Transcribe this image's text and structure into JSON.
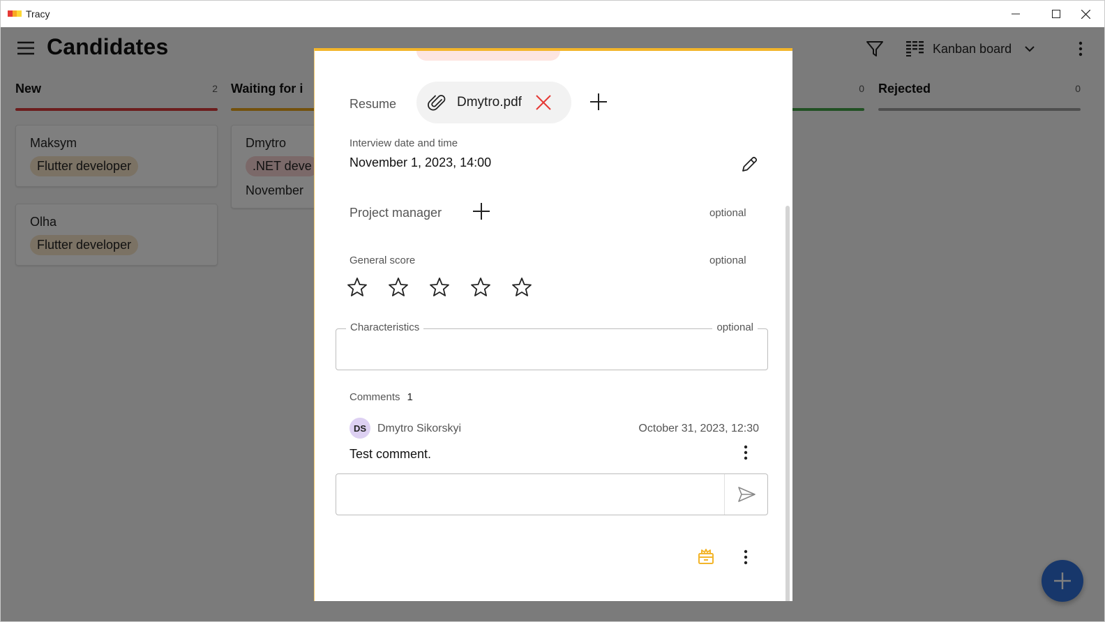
{
  "window": {
    "title": "Tracy",
    "logo_colors": [
      "#e53935",
      "#f9a825",
      "#fdd835"
    ]
  },
  "toolbar": {
    "title": "Candidates",
    "view_label": "Kanban board"
  },
  "columns": [
    {
      "name": "New",
      "count": "2",
      "color": "#d93a3a",
      "cards": [
        {
          "name": "Maksym",
          "position": "Flutter developer",
          "chip_color": "#f6e5c8"
        },
        {
          "name": "Olha",
          "position": "Flutter developer",
          "chip_color": "#f6e5c8"
        }
      ]
    },
    {
      "name": "Waiting for i",
      "count": "",
      "color": "#e6a21a",
      "cards": [
        {
          "name": "Dmytro",
          "position": ".NET deve",
          "chip_color": "#f6d2d2",
          "date": "November"
        }
      ]
    },
    {
      "name": "",
      "count": "0",
      "color": "#43a047",
      "cards": []
    },
    {
      "name": "Rejected",
      "count": "0",
      "color": "#9e9e9e",
      "cards": []
    }
  ],
  "dialog": {
    "resume": {
      "label": "Resume",
      "file_name": "Dmytro.pdf"
    },
    "interview": {
      "label": "Interview date and time",
      "value": "November 1, 2023, 14:00"
    },
    "project_manager": {
      "label": "Project manager",
      "optional": "optional"
    },
    "general_score": {
      "label": "General score",
      "optional": "optional",
      "rating": 0,
      "max": 5
    },
    "characteristics": {
      "label": "Characteristics",
      "optional": "optional",
      "value": ""
    },
    "comments": {
      "label": "Comments",
      "count": "1",
      "items": [
        {
          "initials": "DS",
          "author": "Dmytro Sikorskyi",
          "date": "October 31, 2023, 12:30",
          "text": "Test comment."
        }
      ],
      "new_comment_value": ""
    }
  },
  "colors": {
    "accent": "#f3b52a",
    "fab": "#2f6fd6",
    "remove": "#e53935",
    "avatar": "#ddd0f2"
  }
}
